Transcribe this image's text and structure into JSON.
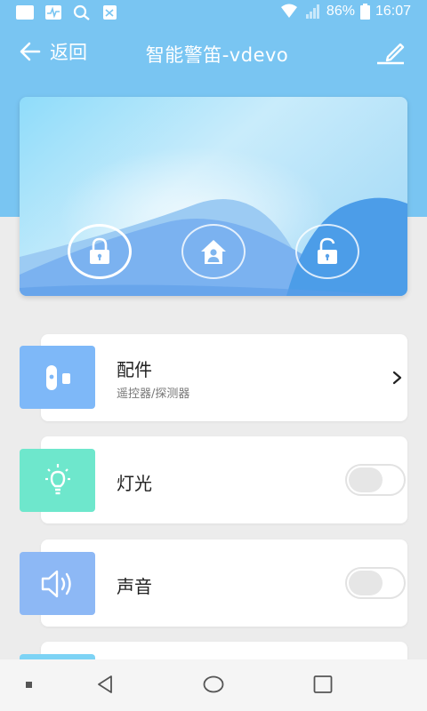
{
  "status_bar": {
    "battery": "86%",
    "time": "16:07",
    "icons": [
      "notification-icon",
      "activity-icon",
      "search-icon",
      "image-icon",
      "wifi-icon",
      "signal-icon",
      "battery-icon"
    ]
  },
  "header": {
    "back_label": "返回",
    "title": "智能警笛-vdevo",
    "edit_icon": "edit-icon"
  },
  "hero": {
    "modes": [
      {
        "icon": "lock-icon",
        "active": true
      },
      {
        "icon": "home-user-icon",
        "active": false
      },
      {
        "icon": "unlock-icon",
        "active": false
      }
    ]
  },
  "list": {
    "items": [
      {
        "title": "配件",
        "subtitle": "遥控器/探测器",
        "control": "chevron",
        "icon": "accessory-icon",
        "color": "#7eb8f8"
      },
      {
        "title": "灯光",
        "control": "toggle",
        "state": false,
        "icon": "bulb-icon",
        "color": "#6ee7cc"
      },
      {
        "title": "声音",
        "control": "toggle",
        "state": false,
        "icon": "speaker-icon",
        "color": "#8db8f5"
      }
    ]
  },
  "colors": {
    "header_bg": "#79c5f2",
    "page_bg": "#ececec"
  },
  "nav_bar": {
    "icons": [
      "menu-dot-icon",
      "back-triangle-icon",
      "home-circle-icon",
      "recents-square-icon"
    ]
  }
}
